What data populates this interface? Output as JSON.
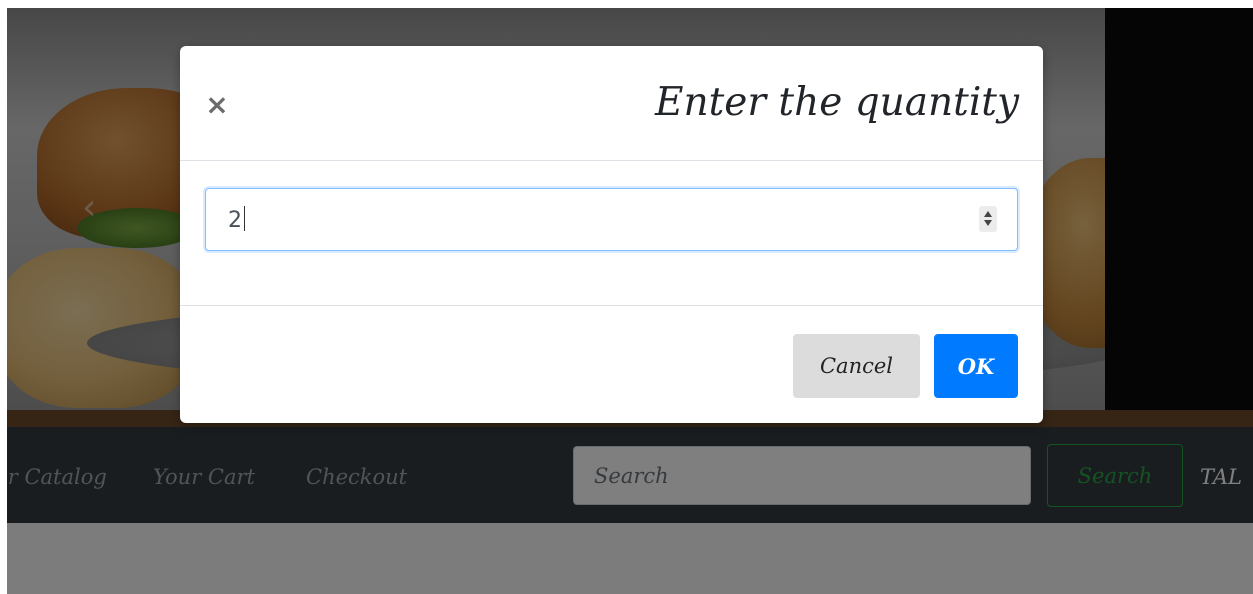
{
  "navbar": {
    "links": [
      {
        "label": "Our Catalog"
      },
      {
        "label": "Your Cart"
      },
      {
        "label": "Checkout"
      }
    ],
    "search_placeholder": "Search",
    "search_button": "Search",
    "user_label": "TAL"
  },
  "modal": {
    "close_symbol": "×",
    "title": "Enter the quantity",
    "quantity_value": "2",
    "cancel_label": "Cancel",
    "ok_label": "OK"
  },
  "carousel": {
    "prev_symbol": "‹"
  },
  "colors": {
    "primary": "#007bff",
    "success": "#28a745",
    "navbar_bg": "#343a40"
  },
  "icons": [
    "close-icon",
    "chevron-left-icon",
    "spinner-up-icon",
    "spinner-down-icon"
  ]
}
